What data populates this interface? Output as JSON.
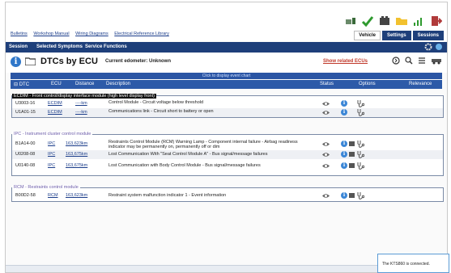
{
  "libraries": [
    "Bulletins",
    "Workshop Manual",
    "Wiring Diagrams",
    "Electrical Reference Library"
  ],
  "vehicle_tabs": [
    "Vehicle",
    "Settings",
    "Sessions"
  ],
  "menu": [
    "Session",
    "Selected Symptoms",
    "Service Functions"
  ],
  "header": {
    "title": "DTCs by ECU",
    "odometer": "Current edometer: Unknown",
    "show_related": "Show related ECUs",
    "event_bar": "Click to display event chart"
  },
  "columns": {
    "dtc": "DTC",
    "ecu": "ECU",
    "distance": "Distance",
    "description": "Description",
    "status": "Status",
    "options": "Options",
    "relevance": "Relevance"
  },
  "groups": [
    {
      "title": "ECDIM - Front control/display interface module (high level display front)",
      "rows": [
        {
          "dtc": "U3003-16",
          "ecu": "ECDIM",
          "dist": "----km",
          "desc": "Control Module - Circuit voltage below threshold",
          "folder": false
        },
        {
          "dtc": "U1A01-15",
          "ecu": "ECDIM",
          "dist": "----km",
          "desc": "Communications link - Circuit short to battery or open",
          "folder": false
        }
      ]
    },
    {
      "title": "IPC - Instrument cluster control module",
      "rows": [
        {
          "dtc": "B1A14-00",
          "ecu": "IPC",
          "dist": "163,623km",
          "desc": "Restraints Control Module (RCM) Warning Lamp - Component internal failure - Airbag readiness indicator may be permanently on, permanently off or dim",
          "folder": true
        },
        {
          "dtc": "U0208-08",
          "ecu": "IPC",
          "dist": "163,675km",
          "desc": "Lost Communication With \"Seat Control Module A\" - Bus signal/message failures",
          "folder": true
        },
        {
          "dtc": "U0140-08",
          "ecu": "IPC",
          "dist": "163,675km",
          "desc": "Lost Communication with Body Control Module - Bus signal/message failures",
          "folder": true
        }
      ]
    },
    {
      "title": "RCM - Restraints control module",
      "rows": [
        {
          "dtc": "B00D2-58",
          "ecu": "RCM",
          "dist": "163,623km",
          "desc": "Restraint system malfunction indicator 1 - Event information",
          "folder": true
        }
      ]
    }
  ],
  "status_popup": "The KTS860 is connected.",
  "colors": {
    "navy": "#1e3f7a",
    "blue": "#2d5aa8",
    "red": "#c0392b"
  }
}
